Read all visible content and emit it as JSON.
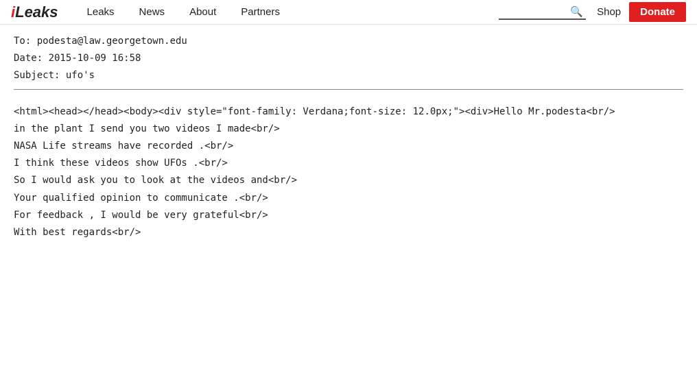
{
  "brand": {
    "text_i": "i",
    "text_leaks": "Leaks"
  },
  "nav": {
    "links": [
      {
        "label": "Leaks",
        "href": "#"
      },
      {
        "label": "News",
        "href": "#"
      },
      {
        "label": "About",
        "href": "#"
      },
      {
        "label": "Partners",
        "href": "#"
      }
    ],
    "search_placeholder": "Search",
    "shop_label": "Shop",
    "donate_label": "Donate"
  },
  "email": {
    "to": "To: podesta@law.georgetown.edu",
    "date": "Date: 2015-10-09 16:58",
    "subject": "Subject: ufo's",
    "body": "<html><head></head><body><div style=\"font-family: Verdana;font-size: 12.0px;\"><div>Hello Mr.podesta<br/>\nin the plant I send you two videos I made<br/>\nNASA Life streams have recorded .<br/>\nI think these videos show UFOs .<br/>\nSo I would ask you to look at the videos and<br/>\nYour qualified opinion to communicate .<br/>\nFor feedback , I would be very grateful<br/>\nWith best regards<br/>"
  }
}
